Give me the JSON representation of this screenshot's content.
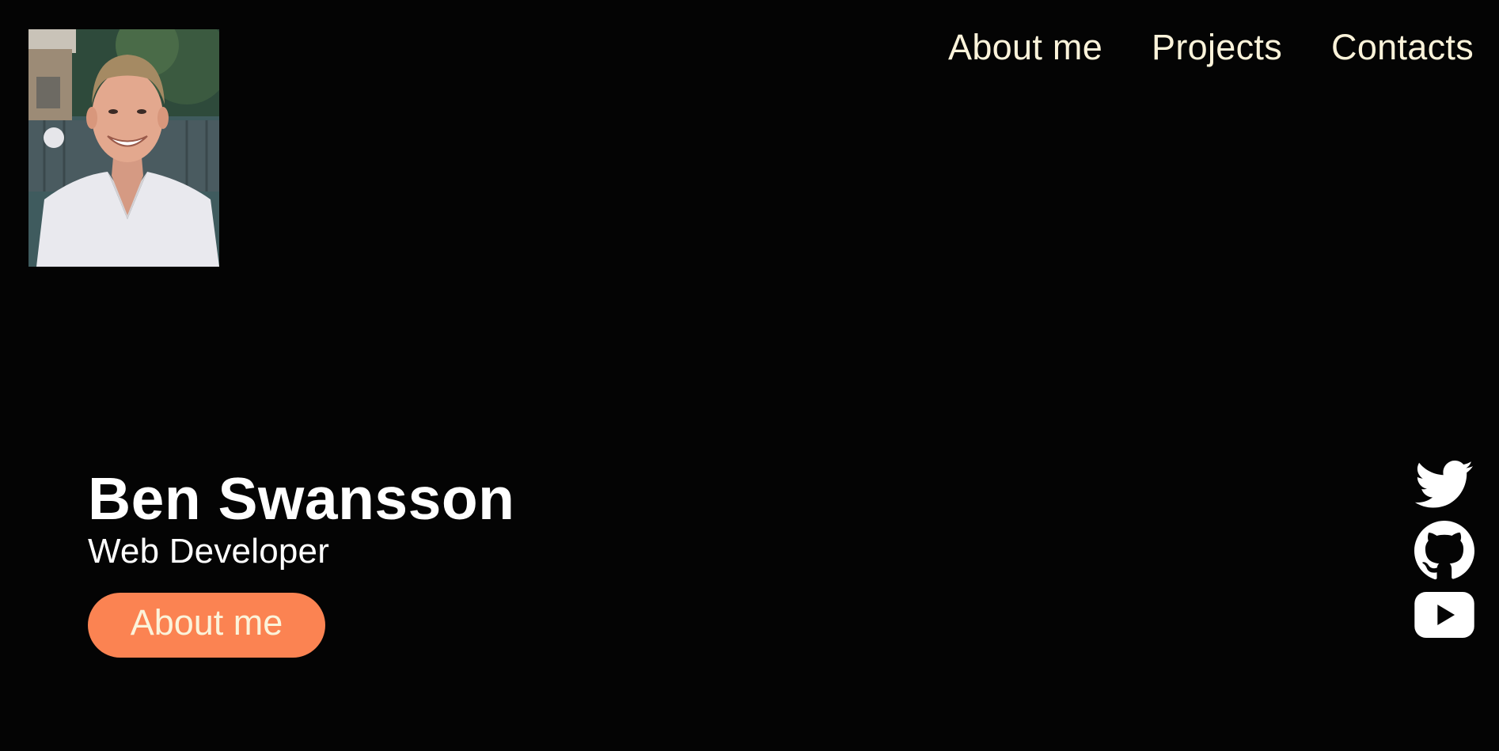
{
  "nav": {
    "items": [
      {
        "label": "About me"
      },
      {
        "label": "Projects"
      },
      {
        "label": "Contacts"
      }
    ]
  },
  "hero": {
    "name": "Ben Swansson",
    "role": "Web Developer",
    "cta_label": "About me"
  },
  "social": {
    "icons": [
      "twitter-icon",
      "github-icon",
      "youtube-icon"
    ]
  },
  "colors": {
    "background": "#040404",
    "nav_text": "#fbf3da",
    "accent": "#fb8352",
    "hero_text": "#ffffff"
  }
}
